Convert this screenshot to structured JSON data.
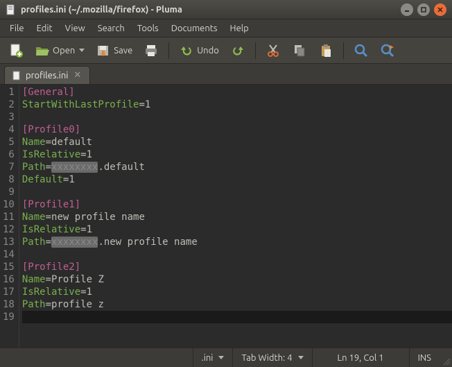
{
  "window": {
    "title": "profiles.ini (~/.mozilla/firefox) - Pluma"
  },
  "menubar": [
    "File",
    "Edit",
    "View",
    "Search",
    "Tools",
    "Documents",
    "Help"
  ],
  "toolbar": {
    "open_label": "Open",
    "save_label": "Save",
    "undo_label": "Undo"
  },
  "tabs": [
    {
      "label": "profiles.ini"
    }
  ],
  "editor": {
    "lines": [
      {
        "n": 1,
        "type": "section",
        "text": "[General]"
      },
      {
        "n": 2,
        "type": "kv",
        "key": "StartWithLastProfile",
        "val": "1"
      },
      {
        "n": 3,
        "type": "blank"
      },
      {
        "n": 4,
        "type": "section",
        "text": "[Profile0]"
      },
      {
        "n": 5,
        "type": "kv",
        "key": "Name",
        "val": "default"
      },
      {
        "n": 6,
        "type": "kv",
        "key": "IsRelative",
        "val": "1"
      },
      {
        "n": 7,
        "type": "kv",
        "key": "Path",
        "smudge": "xxxxxxxx",
        "val": ".default"
      },
      {
        "n": 8,
        "type": "kv",
        "key": "Default",
        "val": "1"
      },
      {
        "n": 9,
        "type": "blank"
      },
      {
        "n": 10,
        "type": "section",
        "text": "[Profile1]"
      },
      {
        "n": 11,
        "type": "kv",
        "key": "Name",
        "val": "new profile name"
      },
      {
        "n": 12,
        "type": "kv",
        "key": "IsRelative",
        "val": "1"
      },
      {
        "n": 13,
        "type": "kv",
        "key": "Path",
        "smudge": "xxxxxxxx",
        "val": ".new profile name"
      },
      {
        "n": 14,
        "type": "blank"
      },
      {
        "n": 15,
        "type": "section",
        "text": "[Profile2]"
      },
      {
        "n": 16,
        "type": "kv",
        "key": "Name",
        "val": "Profile Z"
      },
      {
        "n": 17,
        "type": "kv",
        "key": "IsRelative",
        "val": "1"
      },
      {
        "n": 18,
        "type": "kv",
        "key": "Path",
        "val": "profile z"
      },
      {
        "n": 19,
        "type": "current"
      }
    ]
  },
  "statusbar": {
    "filetype": ".ini",
    "tabwidth_label": "Tab Width: 4",
    "cursor": "Ln 19, Col 1",
    "mode": "INS"
  }
}
